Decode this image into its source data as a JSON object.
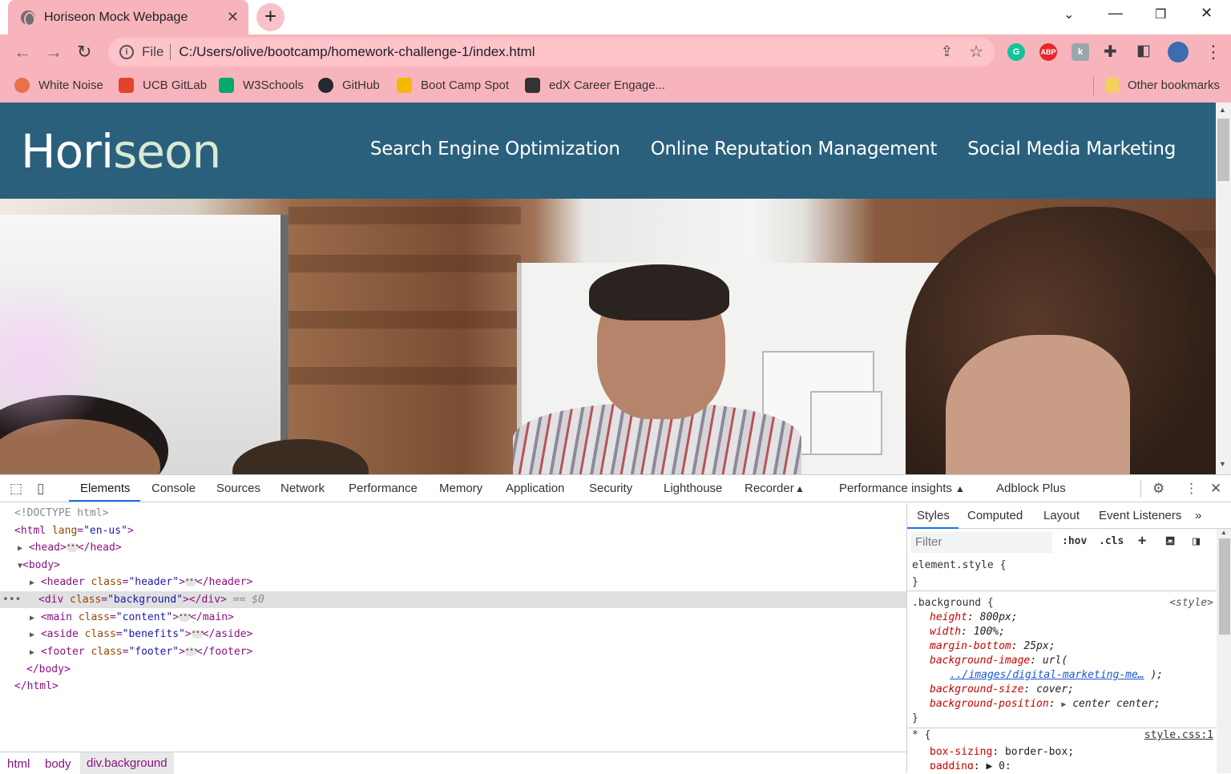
{
  "browser": {
    "tab_title": "Horiseon Mock Webpage",
    "new_tab": "+",
    "address": {
      "scheme_label": "File",
      "url": "C:/Users/olive/bootcamp/homework-challenge-1/index.html"
    },
    "bookmarks": [
      {
        "label": "White Noise",
        "color": "#e8704a"
      },
      {
        "label": "UCB GitLab",
        "color": "#e24329"
      },
      {
        "label": "W3Schools",
        "color": "#04aa6d"
      },
      {
        "label": "GitHub",
        "color": "#24292f"
      },
      {
        "label": "Boot Camp Spot",
        "color": "#f5b800"
      },
      {
        "label": "edX Career Engage...",
        "color": "#333333"
      }
    ],
    "other_bookmarks": "Other bookmarks",
    "extensions": [
      {
        "name": "grammarly-icon",
        "label": "G",
        "color": "#15c39a"
      },
      {
        "name": "adblock-plus-icon",
        "label": "ABP",
        "color": "#e4282e"
      },
      {
        "name": "extension-k-icon",
        "label": "k",
        "color": "#9aa7ad"
      }
    ]
  },
  "site": {
    "logo_main": "Hori",
    "logo_accent": "seon",
    "nav": [
      "Search Engine Optimization",
      "Online Reputation Management",
      "Social Media Marketing"
    ],
    "header_color": "#2a607c"
  },
  "devtools": {
    "tabs": [
      "Elements",
      "Console",
      "Sources",
      "Network",
      "Performance",
      "Memory",
      "Application",
      "Security",
      "Lighthouse",
      "Recorder",
      "Performance insights",
      "Adblock Plus"
    ],
    "active_tab": "Elements",
    "dom": {
      "doctype": "<!DOCTYPE html>",
      "html_open": "<html",
      "html_attr": "lang",
      "html_val": "\"en-us\"",
      "head_open": "<head>",
      "head_close": "</head>",
      "body_open": "<body>",
      "header_open": "<header",
      "header_class": "\"header\"",
      "header_close": "</header>",
      "div_open": "<div",
      "div_class": "\"background\"",
      "div_close": "></div>",
      "selected_marker": "== $0",
      "main_open": "<main",
      "main_class": "\"content\"",
      "main_close": "</main>",
      "aside_open": "<aside",
      "aside_class": "\"benefits\"",
      "aside_close": "</aside>",
      "footer_open": "<footer",
      "footer_class": "\"footer\"",
      "footer_close": "</footer>",
      "body_close": "</body>",
      "html_close": "</html>",
      "class_attr": "class"
    },
    "breadcrumbs": [
      "html",
      "body",
      "div.background"
    ],
    "styles_tabs": [
      "Styles",
      "Computed",
      "Layout",
      "Event Listeners"
    ],
    "filter_placeholder": "Filter",
    "hov": ":hov",
    "cls": ".cls",
    "rules": {
      "element_style": "element.style {",
      "close": "}",
      "background_selector": ".background {",
      "background_source": "<style>",
      "background_props": [
        {
          "prop": "height",
          "value": "800px;"
        },
        {
          "prop": "width",
          "value": "100%;"
        },
        {
          "prop": "margin-bottom",
          "value": "25px;"
        },
        {
          "prop": "background-image",
          "value": "url("
        }
      ],
      "background_image_link": "../images/digital-marketing-me…",
      "background_image_end": ");",
      "background_size": {
        "prop": "background-size",
        "value": "cover;"
      },
      "background_position": {
        "prop": "background-position",
        "value": "center center;"
      },
      "universal_selector": "* {",
      "universal_source": "style.css:1",
      "universal_props": [
        {
          "prop": "box-sizing",
          "value": "border-box;"
        },
        {
          "prop": "padding",
          "value": "0;"
        }
      ]
    }
  }
}
